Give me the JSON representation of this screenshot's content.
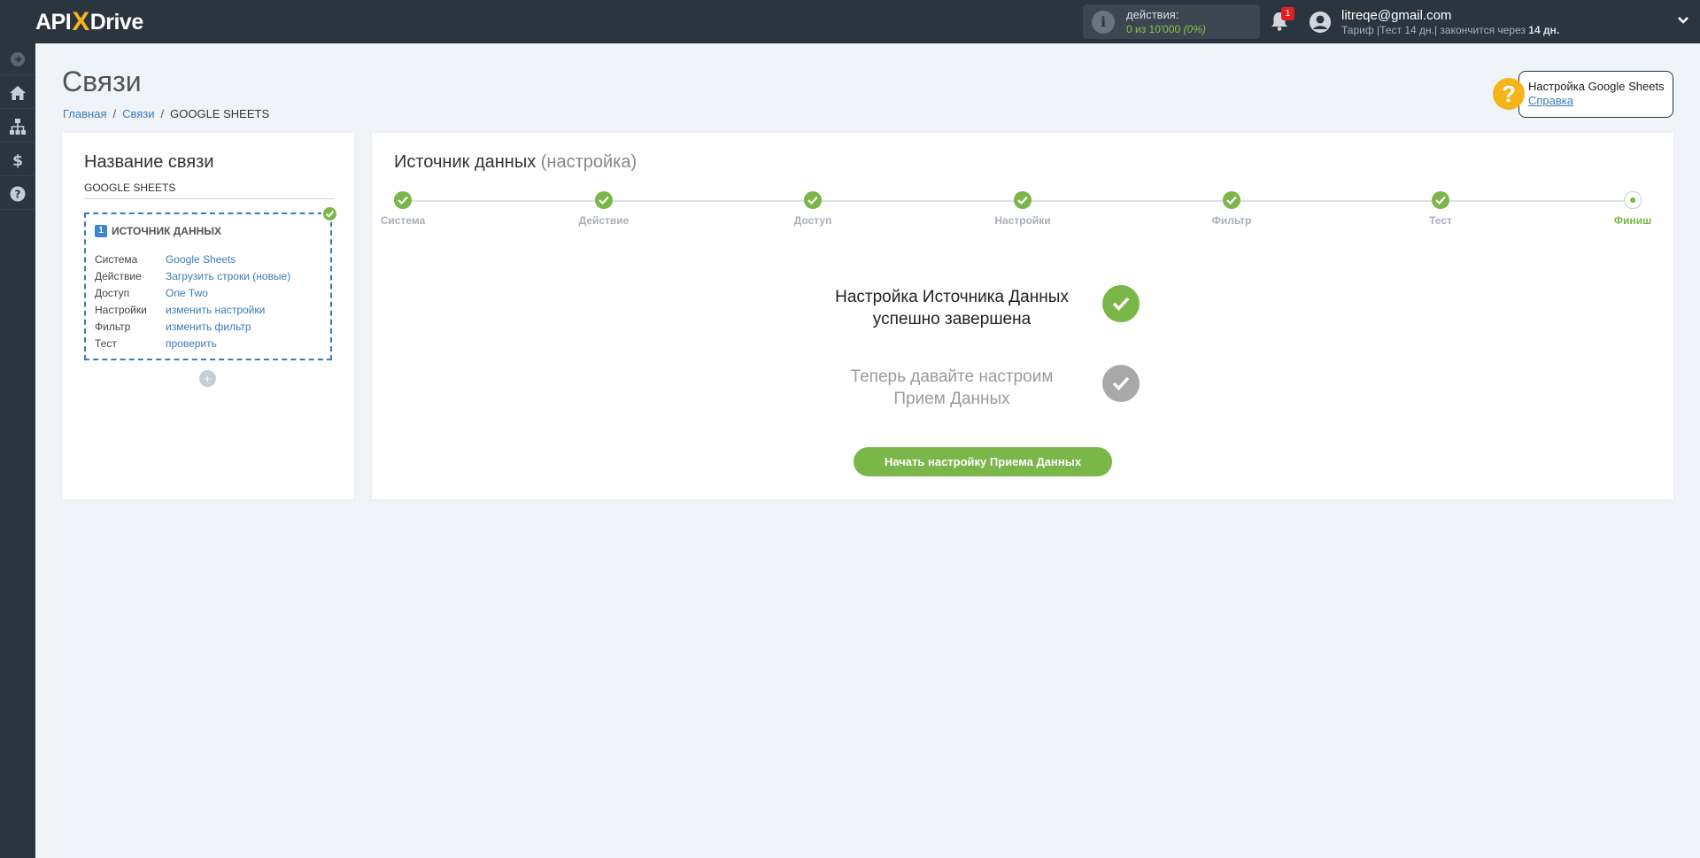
{
  "brand": {
    "part1": "API",
    "x": "X",
    "part2": "Drive"
  },
  "topbar": {
    "actions_label": "действия:",
    "actions_value": "0 из 10'000",
    "actions_pct": "(0%)",
    "notifications_count": "1",
    "user_email": "litreqe@gmail.com",
    "tariff_prefix": "Тариф |Тест 14 дн.| закончится через ",
    "tariff_days": "14 дн."
  },
  "sidebar": {
    "items": [
      "arrow-right-icon",
      "home-icon",
      "sitemap-icon",
      "dollar-icon",
      "question-icon"
    ]
  },
  "page": {
    "title": "Связи",
    "breadcrumb": {
      "home": "Главная",
      "links": "Связи",
      "current": "GOOGLE SHEETS"
    }
  },
  "help": {
    "title": "Настройка Google Sheets",
    "link": "Справка",
    "icon": "?"
  },
  "left_card": {
    "title": "Название связи",
    "connection_name": "GOOGLE SHEETS",
    "source": {
      "num": "1",
      "header": "ИСТОЧНИК ДАННЫХ",
      "rows": [
        {
          "k": "Система",
          "v": "Google Sheets"
        },
        {
          "k": "Действие",
          "v": "Загрузить строки (новые)"
        },
        {
          "k": "Доступ",
          "v": "One Two"
        },
        {
          "k": "Настройки",
          "v": "изменить настройки"
        },
        {
          "k": "Фильтр",
          "v": "изменить фильтр"
        },
        {
          "k": "Тест",
          "v": "проверить"
        }
      ]
    },
    "add_symbol": "+"
  },
  "right_card": {
    "title": "Источник данных",
    "subtitle": "(настройка)",
    "steps": [
      "Система",
      "Действие",
      "Доступ",
      "Настройки",
      "Фильтр",
      "Тест",
      "Финиш"
    ],
    "message_done_line1": "Настройка Источника Данных",
    "message_done_line2": "успешно завершена",
    "message_next_line1": "Теперь давайте настроим",
    "message_next_line2": "Прием Данных",
    "start_button": "Начать настройку Приема Данных"
  },
  "colors": {
    "accent_green": "#7ab648",
    "link_blue": "#3a7cb8",
    "dark_bar": "#2b3540",
    "help_yellow": "#f6b41b"
  }
}
